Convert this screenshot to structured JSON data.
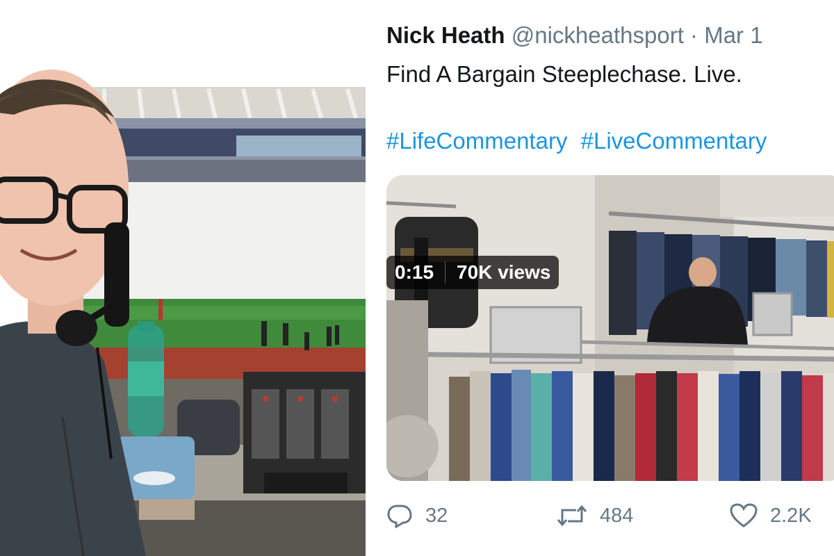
{
  "tweet": {
    "author_name": "Nick Heath",
    "handle": "@nickheathsport",
    "separator": "·",
    "date": "Mar 1",
    "text": "Find A Bargain Steeplechase. Live.",
    "hashtags": [
      "#LifeCommentary",
      "#LiveCommentary"
    ],
    "video": {
      "duration": "0:15",
      "views": "70K views"
    },
    "actions": {
      "replies": "32",
      "retweets": "484",
      "likes": "2.2K"
    }
  },
  "icons": {
    "reply": "reply-icon",
    "retweet": "retweet-icon",
    "like": "heart-icon"
  },
  "colors": {
    "link_blue": "#1b95e0",
    "secondary_gray": "#657786",
    "text_dark": "#14171a"
  }
}
